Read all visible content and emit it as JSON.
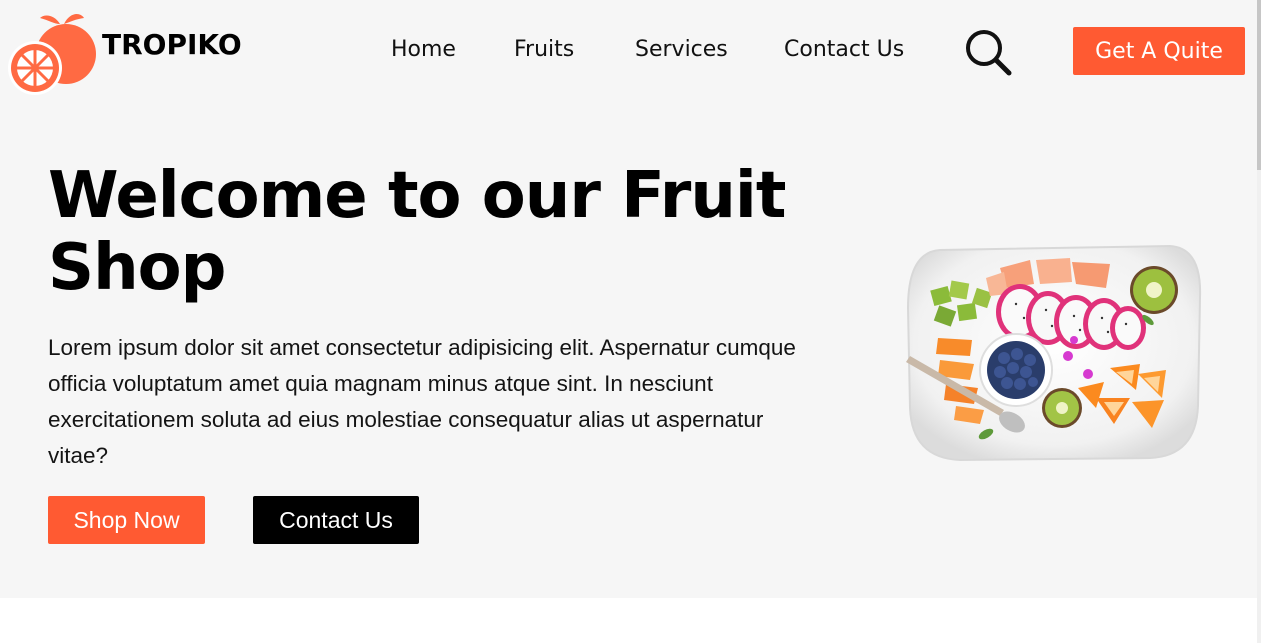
{
  "header": {
    "brand": "TROPIKO",
    "logo_icon": "orange-fruit-icon",
    "nav": {
      "home": "Home",
      "fruits": "Fruits",
      "services": "Services",
      "contact": "Contact Us"
    },
    "search_icon": "search-icon",
    "cta_label": "Get A Quite"
  },
  "hero": {
    "title": "Welcome to our Fruit Shop",
    "description": "Lorem ipsum dolor sit amet consectetur adipisicing elit. Aspernatur cumque officia voluptatum amet quia magnam minus atque sint. In nesciunt exercitationem soluta ad eius molestiae consequatur alias ut aspernatur vitae?",
    "shop_button": "Shop Now",
    "contact_button": "Contact Us",
    "image": "fruit-platter-image"
  },
  "colors": {
    "accent": "#ff5a32",
    "hero_background": "#f6f6f6",
    "dark_button": "#000000"
  }
}
